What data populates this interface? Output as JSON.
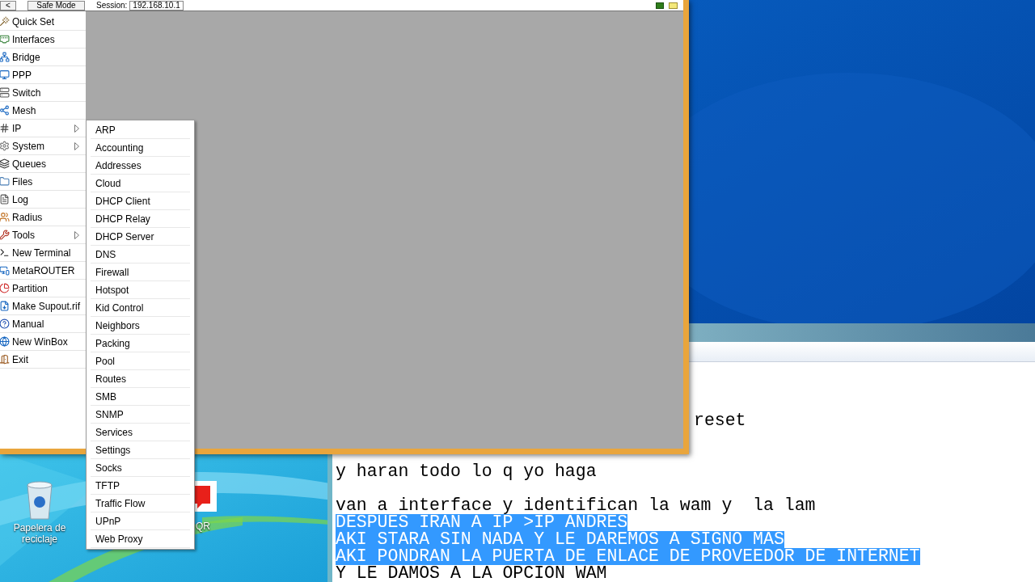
{
  "winbox": {
    "toolbar": {
      "back_button": "<",
      "safe_mode_button": "Safe Mode",
      "session_label": "Session:",
      "session_value": "192.168.10.1"
    },
    "menu": [
      {
        "label": "Quick Set",
        "submenu": false
      },
      {
        "label": "Interfaces",
        "submenu": false
      },
      {
        "label": "Bridge",
        "submenu": false
      },
      {
        "label": "PPP",
        "submenu": false
      },
      {
        "label": "Switch",
        "submenu": false
      },
      {
        "label": "Mesh",
        "submenu": false
      },
      {
        "label": "IP",
        "submenu": true
      },
      {
        "label": "System",
        "submenu": true
      },
      {
        "label": "Queues",
        "submenu": false
      },
      {
        "label": "Files",
        "submenu": false
      },
      {
        "label": "Log",
        "submenu": false
      },
      {
        "label": "Radius",
        "submenu": false
      },
      {
        "label": "Tools",
        "submenu": true
      },
      {
        "label": "New Terminal",
        "submenu": false
      },
      {
        "label": "MetaROUTER",
        "submenu": false
      },
      {
        "label": "Partition",
        "submenu": false
      },
      {
        "label": "Make Supout.rif",
        "submenu": false
      },
      {
        "label": "Manual",
        "submenu": false
      },
      {
        "label": "New WinBox",
        "submenu": false
      },
      {
        "label": "Exit",
        "submenu": false
      }
    ],
    "submenu": [
      "ARP",
      "Accounting",
      "Addresses",
      "Cloud",
      "DHCP Client",
      "DHCP Relay",
      "DHCP Server",
      "DNS",
      "Firewall",
      "Hotspot",
      "Kid Control",
      "Neighbors",
      "Packing",
      "Pool",
      "Routes",
      "SMB",
      "SNMP",
      "Services",
      "Settings",
      "Socks",
      "TFTP",
      "Traffic Flow",
      "UPnP",
      "Web Proxy"
    ]
  },
  "desktop_icons": [
    {
      "label": "Papelera de reciclaje"
    },
    {
      "label": "QR"
    }
  ],
  "editor": {
    "lines": [
      {
        "kind": "partial",
        "text": "reset",
        "selected": false
      },
      {
        "kind": "blank"
      },
      {
        "kind": "blank"
      },
      {
        "kind": "text",
        "text": "y haran todo lo q yo haga",
        "selected": false
      },
      {
        "kind": "blank"
      },
      {
        "kind": "text",
        "text": "van a interface y identifican la wam y  la lam",
        "selected": false
      },
      {
        "kind": "text",
        "text": "DESPUES IRAN A IP >IP ANDRES",
        "selected": true
      },
      {
        "kind": "text",
        "text": "AKI STARA SIN NADA Y LE DAREMOS A SIGNO MAS",
        "selected": true
      },
      {
        "kind": "text",
        "text": "AKI PONDRAN LA PUERTA DE ENLACE DE PROVEEDOR DE INTERNET",
        "selected": true
      },
      {
        "kind": "text",
        "text": "Y LE DAMOS A LA OPCION WAM",
        "selected": false
      }
    ]
  }
}
